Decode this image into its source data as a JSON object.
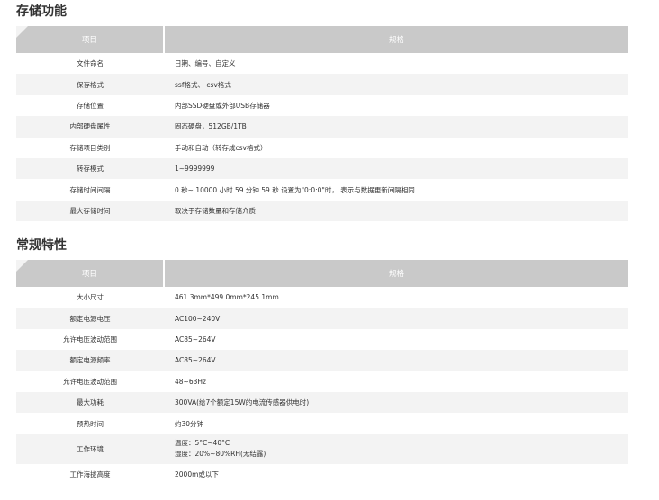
{
  "sections": [
    {
      "title": "存储功能",
      "header": {
        "item": "项目",
        "spec": "规格"
      },
      "rows": [
        {
          "k": "文件命名",
          "v": [
            "日期、编号、自定义"
          ]
        },
        {
          "k": "保存格式",
          "v": [
            "ssf格式、 csv格式"
          ]
        },
        {
          "k": "存储位置",
          "v": [
            "内部SSD硬盘或外部USB存储器"
          ]
        },
        {
          "k": "内部硬盘属性",
          "v": [
            "固态硬盘，512GB/1TB"
          ]
        },
        {
          "k": "存储项目类别",
          "v": [
            "手动和自动（转存成csv格式）"
          ]
        },
        {
          "k": "转存模式",
          "v": [
            "1~9999999"
          ]
        },
        {
          "k": "存储时间间隔",
          "v": [
            "0 秒~ 10000 小时 59 分钟 59 秒 设置为\"0:0:0\"时， 表示与数据更新间隔相同"
          ]
        },
        {
          "k": "最大存储时间",
          "v": [
            "取决于存储数量和存储介质"
          ]
        }
      ]
    },
    {
      "title": "常规特性",
      "header": {
        "item": "项目",
        "spec": "规格"
      },
      "rows": [
        {
          "k": "大小尺寸",
          "v": [
            "461.3mm*499.0mm*245.1mm"
          ]
        },
        {
          "k": "额定电源电压",
          "v": [
            "AC100~240V"
          ]
        },
        {
          "k": "允许电压波动范围",
          "v": [
            "AC85~264V"
          ]
        },
        {
          "k": "额定电源频率",
          "v": [
            "AC85~264V"
          ]
        },
        {
          "k": "允许电压波动范围",
          "v": [
            "48~63Hz"
          ]
        },
        {
          "k": "最大功耗",
          "v": [
            "300VA(给7个额定15W的电流传感器供电时)"
          ]
        },
        {
          "k": "预热时间",
          "v": [
            "约30分钟"
          ]
        },
        {
          "k": "工作环境",
          "v": [
            "温度：5°C~40°C",
            "湿度：20%~80%RH(无结露)"
          ]
        },
        {
          "k": "工作海拔高度",
          "v": [
            "2000m或以下"
          ]
        }
      ]
    }
  ]
}
